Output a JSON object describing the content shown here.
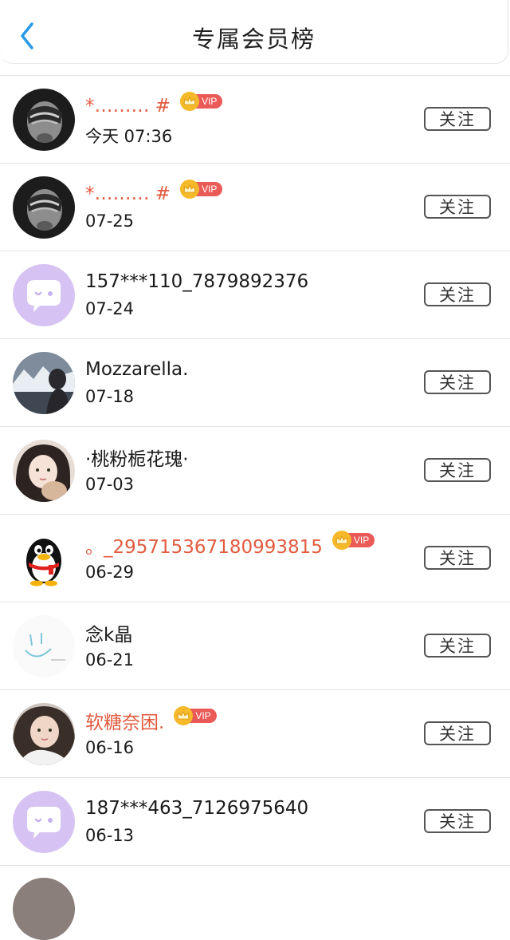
{
  "header": {
    "title": "专属会员榜"
  },
  "vip_label": "VIP",
  "follow_label": "关注",
  "colors": {
    "vip_name": "#e25b3f",
    "back_arrow": "#2a9ae6",
    "vip_badge": "#ea5a57",
    "crown": "#f5b92a"
  },
  "members": [
    {
      "name": "*……… #",
      "time": "今天 07:36",
      "vip": true,
      "avatar": "dark-photo-avatar"
    },
    {
      "name": "*……… #",
      "time": "07-25",
      "vip": true,
      "avatar": "dark-photo-avatar"
    },
    {
      "name": "157***110_7879892376",
      "time": "07-24",
      "vip": false,
      "avatar": "chat-bubble-avatar"
    },
    {
      "name": "Mozzarella.",
      "time": "07-18",
      "vip": false,
      "avatar": "landscape-photo-avatar"
    },
    {
      "name": "·桃粉栀花瑰·",
      "time": "07-03",
      "vip": false,
      "avatar": "girl-photo-avatar"
    },
    {
      "name": "。_295715367180993815",
      "time": "06-29",
      "vip": true,
      "avatar": "qq-penguin-avatar"
    },
    {
      "name": "念k晶",
      "time": "06-21",
      "vip": false,
      "avatar": "sketch-avatar"
    },
    {
      "name": "软糖奈困.",
      "time": "06-16",
      "vip": true,
      "avatar": "girl-photo-avatar-2"
    },
    {
      "name": "187***463_7126975640",
      "time": "06-13",
      "vip": false,
      "avatar": "chat-bubble-avatar"
    }
  ]
}
